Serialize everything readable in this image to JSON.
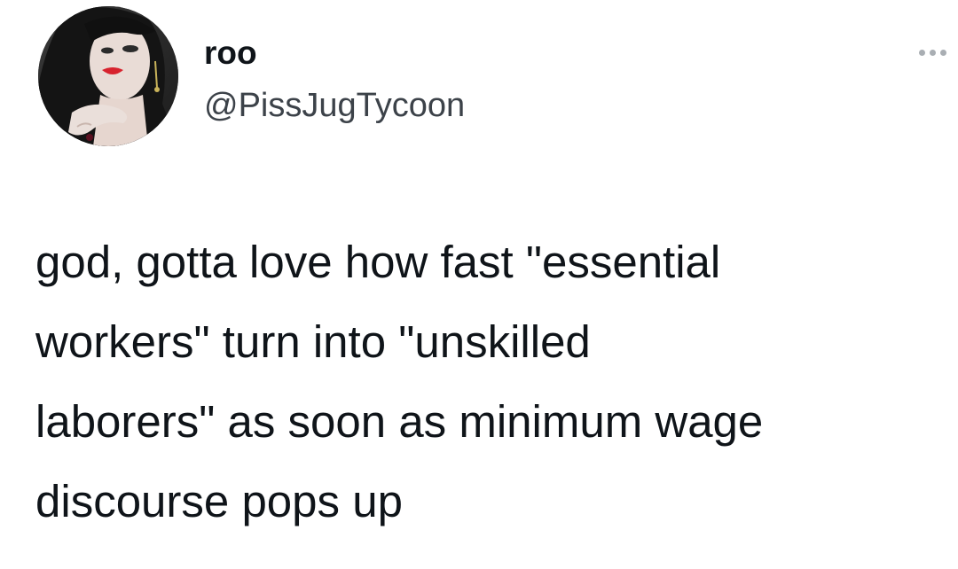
{
  "author": {
    "display_name": "roo",
    "handle": "@PissJugTycoon",
    "avatar_icon": "profile-photo-avatar"
  },
  "more_icon": "more-options-icon",
  "tweet": {
    "lines": [
      "god, gotta love how fast \"essential",
      "workers\" turn into \"unskilled",
      "laborers\" as soon as minimum wage",
      "discourse pops up"
    ]
  },
  "colors": {
    "background": "#ffffff",
    "text": "#0f1419",
    "handle": "#3c4249",
    "more_dots": "#a9aeb3"
  }
}
